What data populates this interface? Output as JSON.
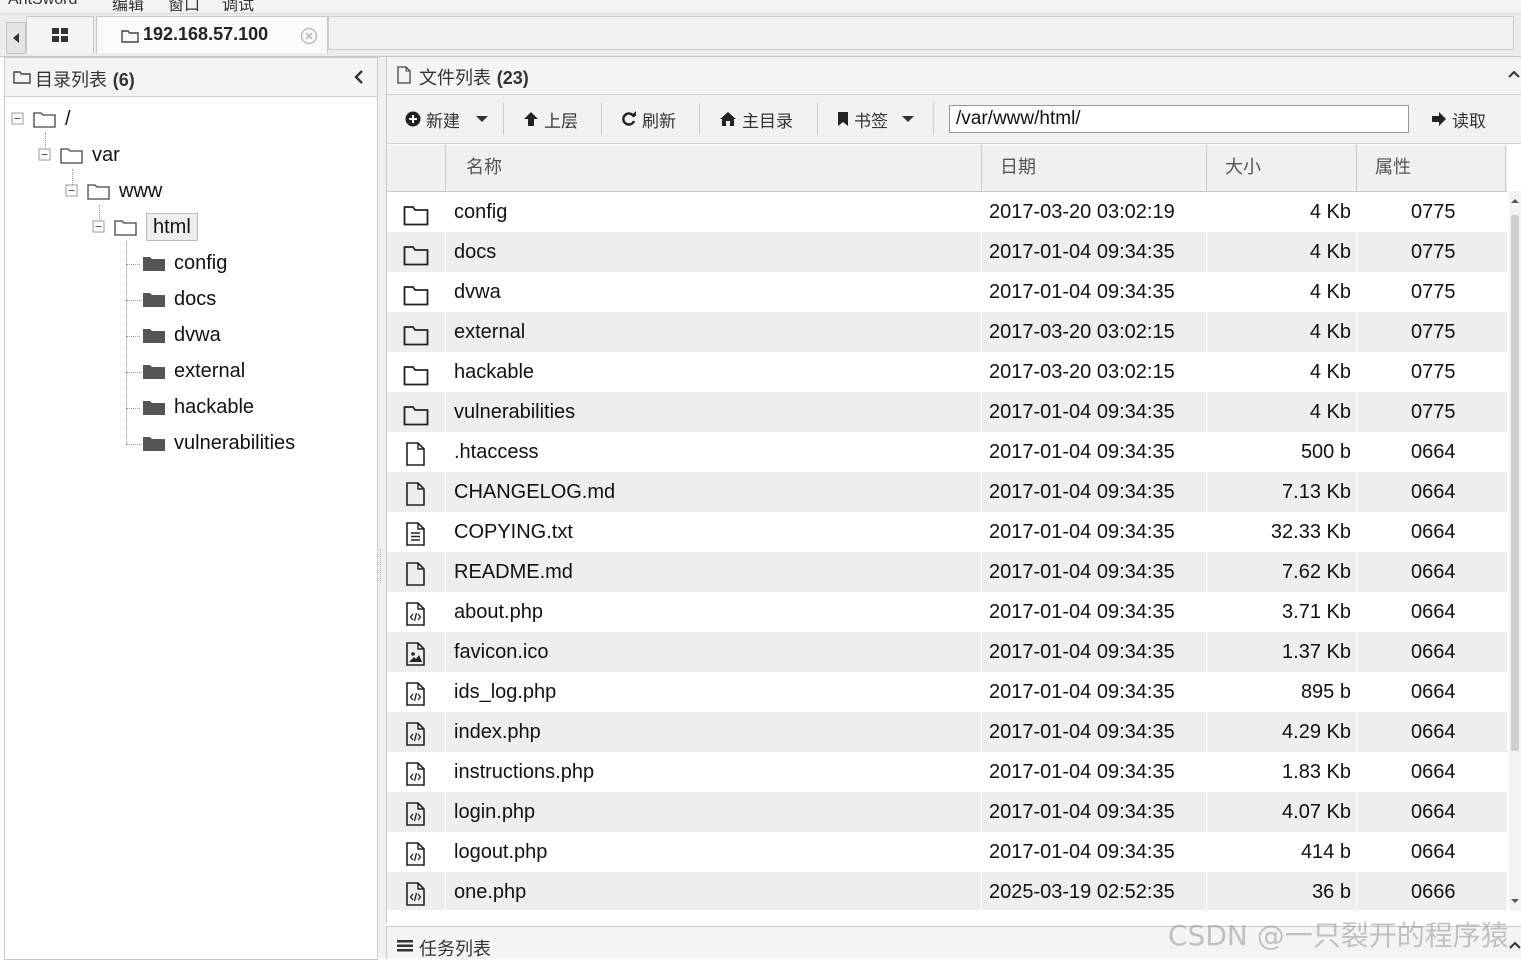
{
  "menu": [
    "AntSword",
    "编辑",
    "窗口",
    "调试"
  ],
  "tab": {
    "host": "192.168.57.100"
  },
  "left_panel": {
    "title": "目录列表",
    "count": "(6)",
    "tree": {
      "root": "/",
      "var": "var",
      "www": "www",
      "html": "html",
      "children": [
        "config",
        "docs",
        "dvwa",
        "external",
        "hackable",
        "vulnerabilities"
      ]
    }
  },
  "right_panel": {
    "title": "文件列表",
    "count": "(23)",
    "toolbar": {
      "new": "新建",
      "up": "上层",
      "refresh": "刷新",
      "home": "主目录",
      "bookmark": "书签",
      "path": "/var/www/html/",
      "read": "读取"
    },
    "columns": {
      "name": "名称",
      "date": "日期",
      "size": "大小",
      "attr": "属性"
    },
    "files": [
      {
        "type": "folder",
        "name": "config",
        "date": "2017-03-20 03:02:19",
        "size": "4 Kb",
        "attr": "0775"
      },
      {
        "type": "folder",
        "name": "docs",
        "date": "2017-01-04 09:34:35",
        "size": "4 Kb",
        "attr": "0775"
      },
      {
        "type": "folder",
        "name": "dvwa",
        "date": "2017-01-04 09:34:35",
        "size": "4 Kb",
        "attr": "0775"
      },
      {
        "type": "folder",
        "name": "external",
        "date": "2017-03-20 03:02:15",
        "size": "4 Kb",
        "attr": "0775"
      },
      {
        "type": "folder",
        "name": "hackable",
        "date": "2017-03-20 03:02:15",
        "size": "4 Kb",
        "attr": "0775"
      },
      {
        "type": "folder",
        "name": "vulnerabilities",
        "date": "2017-01-04 09:34:35",
        "size": "4 Kb",
        "attr": "0775"
      },
      {
        "type": "file",
        "name": ".htaccess",
        "date": "2017-01-04 09:34:35",
        "size": "500 b",
        "attr": "0664"
      },
      {
        "type": "file",
        "name": "CHANGELOG.md",
        "date": "2017-01-04 09:34:35",
        "size": "7.13 Kb",
        "attr": "0664"
      },
      {
        "type": "text",
        "name": "COPYING.txt",
        "date": "2017-01-04 09:34:35",
        "size": "32.33 Kb",
        "attr": "0664"
      },
      {
        "type": "file",
        "name": "README.md",
        "date": "2017-01-04 09:34:35",
        "size": "7.62 Kb",
        "attr": "0664"
      },
      {
        "type": "code",
        "name": "about.php",
        "date": "2017-01-04 09:34:35",
        "size": "3.71 Kb",
        "attr": "0664"
      },
      {
        "type": "image",
        "name": "favicon.ico",
        "date": "2017-01-04 09:34:35",
        "size": "1.37 Kb",
        "attr": "0664"
      },
      {
        "type": "code",
        "name": "ids_log.php",
        "date": "2017-01-04 09:34:35",
        "size": "895 b",
        "attr": "0664"
      },
      {
        "type": "code",
        "name": "index.php",
        "date": "2017-01-04 09:34:35",
        "size": "4.29 Kb",
        "attr": "0664"
      },
      {
        "type": "code",
        "name": "instructions.php",
        "date": "2017-01-04 09:34:35",
        "size": "1.83 Kb",
        "attr": "0664"
      },
      {
        "type": "code",
        "name": "login.php",
        "date": "2017-01-04 09:34:35",
        "size": "4.07 Kb",
        "attr": "0664"
      },
      {
        "type": "code",
        "name": "logout.php",
        "date": "2017-01-04 09:34:35",
        "size": "414 b",
        "attr": "0664"
      },
      {
        "type": "code",
        "name": "one.php",
        "date": "2025-03-19 02:52:35",
        "size": "36 b",
        "attr": "0666"
      }
    ]
  },
  "task_panel": {
    "title": "任务列表"
  },
  "watermark": "CSDN @一只裂开的程序猿"
}
